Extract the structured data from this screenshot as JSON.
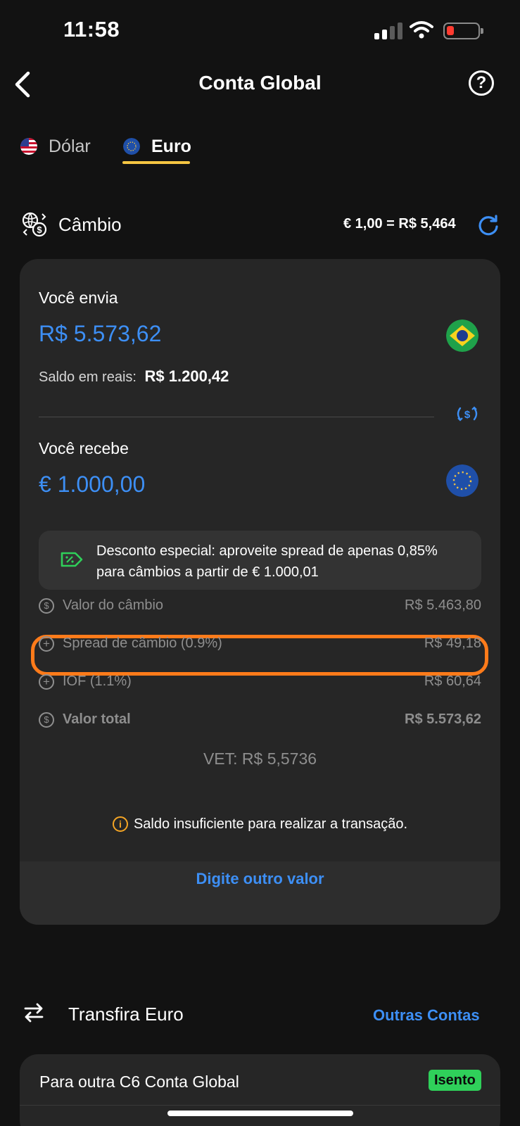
{
  "status_bar": {
    "time": "11:58"
  },
  "nav": {
    "title": "Conta Global",
    "help": "?"
  },
  "tabs": [
    {
      "label": "Dólar",
      "active": false
    },
    {
      "label": "Euro",
      "active": true
    }
  ],
  "cambio": {
    "title": "Câmbio",
    "rate": "€ 1,00 = R$ 5,464"
  },
  "converter": {
    "send_label": "Você envia",
    "send_amount": "R$ 5.573,62",
    "balance_label": "Saldo em reais:",
    "balance_value": "R$ 1.200,42",
    "receive_label": "Você recebe",
    "receive_amount": "€ 1.000,00",
    "promo_text": "Desconto especial: aproveite spread de apenas 0,85% para câmbios a partir de € 1.000,01",
    "rows": [
      {
        "label": "Valor do câmbio",
        "value": "R$ 5.463,80"
      },
      {
        "label": "Spread de câmbio (0.9%)",
        "value": "R$ 49,18"
      },
      {
        "label": "IOF (1.1%)",
        "value": "R$ 60,64"
      },
      {
        "label": "Valor total",
        "value": "R$ 5.573,62"
      }
    ],
    "vet": "VET: R$ 5,5736",
    "warning": "Saldo insuficiente para realizar a transação.",
    "cta": "Digite outro valor"
  },
  "transfer": {
    "title": "Transfira Euro",
    "other_accounts": "Outras Contas",
    "items": [
      {
        "label": "Para outra C6 Conta Global",
        "badge": "Isento"
      }
    ]
  },
  "colors": {
    "accent_blue": "#3d8ff5",
    "tab_underline": "#f5c542",
    "highlight_orange": "#ff7b1a",
    "badge_green": "#2fd05a",
    "warning_orange": "#f5a524"
  }
}
